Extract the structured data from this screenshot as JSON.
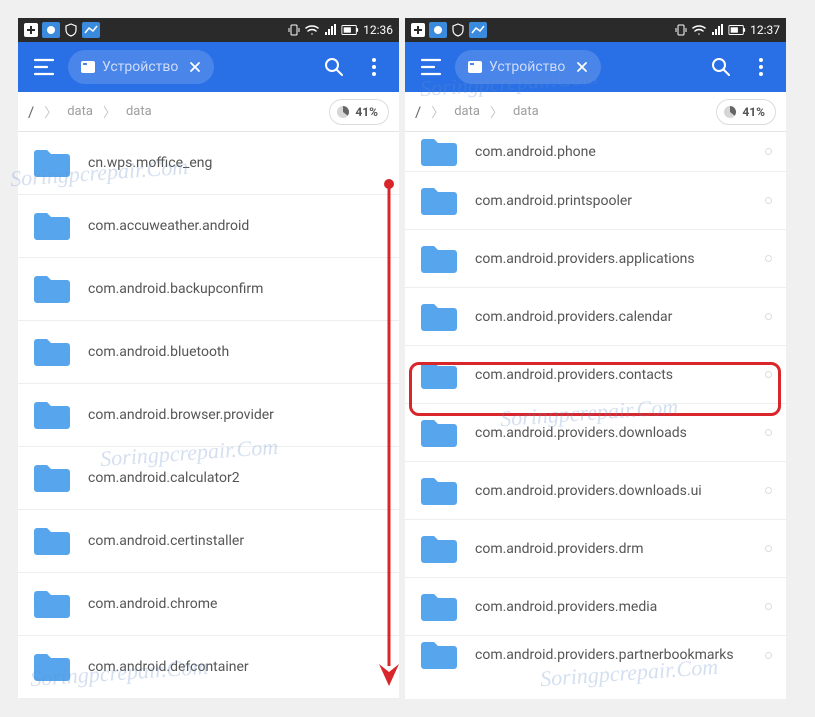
{
  "watermark_text": "Soringpcrepair.Com",
  "left": {
    "status_time": "12:36",
    "tab_label": "Устройство",
    "breadcrumbs": [
      "/",
      "data",
      "data"
    ],
    "storage_percent": "41%",
    "folders": [
      "cn.wps.moffice_eng",
      "com.accuweather.android",
      "com.android.backupconfirm",
      "com.android.bluetooth",
      "com.android.browser.provider",
      "com.android.calculator2",
      "com.android.certinstaller",
      "com.android.chrome",
      "com.android.defcontainer"
    ]
  },
  "right": {
    "status_time": "12:37",
    "tab_label": "Устройство",
    "breadcrumbs": [
      "/",
      "data",
      "data"
    ],
    "storage_percent": "41%",
    "folders": [
      "com.android.phone",
      "com.android.printspooler",
      "com.android.providers.applications",
      "com.android.providers.calendar",
      "com.android.providers.contacts",
      "com.android.providers.downloads",
      "com.android.providers.downloads.ui",
      "com.android.providers.drm",
      "com.android.providers.media",
      "com.android.providers.partnerbookmarks"
    ],
    "highlighted_index": 4
  }
}
